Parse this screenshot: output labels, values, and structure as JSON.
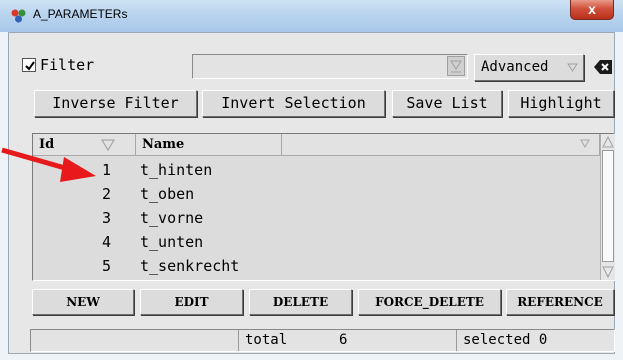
{
  "window": {
    "title": "A_PARAMETERs",
    "close_label": "x"
  },
  "filter": {
    "checked": true,
    "label": "Filter",
    "combo_value": "",
    "advanced_label": "Advanced"
  },
  "toolbar": {
    "inverse_filter": "Inverse Filter",
    "invert_selection": "Invert Selection",
    "save_list": "Save List",
    "highlight": "Highlight"
  },
  "table": {
    "columns": [
      "Id",
      "Name"
    ],
    "rows": [
      {
        "id": "1",
        "name": "t_hinten"
      },
      {
        "id": "2",
        "name": "t_oben"
      },
      {
        "id": "3",
        "name": "t_vorne"
      },
      {
        "id": "4",
        "name": "t_unten"
      },
      {
        "id": "5",
        "name": "t_senkrecht"
      }
    ]
  },
  "actions": {
    "new": "NEW",
    "edit": "EDIT",
    "delete": "DELETE",
    "force_delete": "FORCE_DELETE",
    "reference": "REFERENCE"
  },
  "status": {
    "total_label": "total",
    "total_value": "6",
    "selected_label": "selected",
    "selected_value": "0"
  },
  "colors": {
    "annotation_arrow": "#e8191b",
    "close_button": "#c8402a"
  },
  "icons": [
    "app-icon",
    "checkbox-check-icon",
    "dropdown-arrow-icon",
    "clear-icon",
    "sort-arrow-icon",
    "annotation-arrow"
  ]
}
